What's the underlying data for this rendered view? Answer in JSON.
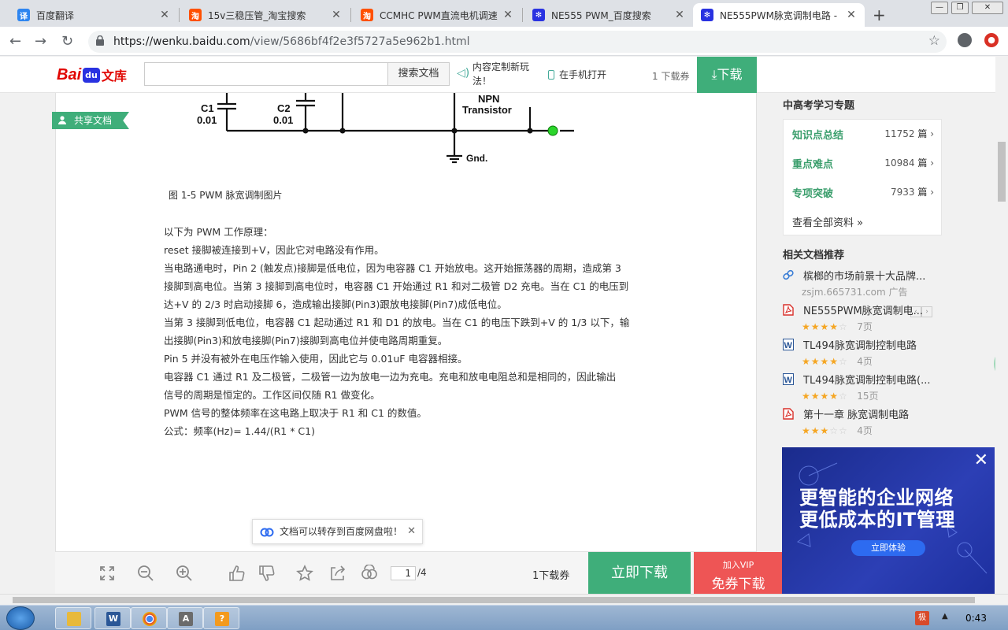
{
  "browser": {
    "tabs": [
      {
        "title": "百度翻译",
        "icon": "baidu-translate-icon",
        "icon_color": "#2d85f0",
        "icon_glyph": "译"
      },
      {
        "title": "15v三稳压管_淘宝搜索",
        "icon": "taobao-icon",
        "icon_color": "#ff5000",
        "icon_glyph": "淘"
      },
      {
        "title": "CCMHC PWM直流电机调速",
        "icon": "taobao-icon",
        "icon_color": "#ff5000",
        "icon_glyph": "淘"
      },
      {
        "title": "NE555 PWM_百度搜索",
        "icon": "baidu-paw-icon",
        "icon_color": "#2932e1",
        "icon_glyph": "✻"
      },
      {
        "title": "NE555PWM脉宽调制电路 -",
        "icon": "baidu-paw-icon",
        "icon_color": "#2932e1",
        "icon_glyph": "✻",
        "active": true
      }
    ],
    "url_host": "https://wenku.baidu.com",
    "url_path": "/view/5686bf4f2e3f5727a5e962b1.html"
  },
  "header": {
    "logo_bai": "Bai",
    "logo_du": "du",
    "logo_wenku": "文库",
    "search_placeholder": "",
    "search_button": "搜索文档",
    "custom_text": "内容定制新玩法！",
    "mobile_text": "在手机打开",
    "download_count": "1 下载券",
    "download_button": "下载"
  },
  "share_tag": "共享文档",
  "figure": {
    "caption": "图 1-5  PWM 脉宽调制图片",
    "labels": {
      "c1": "C1",
      "c1_val": "0.01",
      "c2": "C2",
      "c2_val": "0.01",
      "npn": "NPN",
      "transistor": "Transistor",
      "gnd": "Gnd."
    }
  },
  "body_lines": [
    "以下为 PWM 工作原理：",
    "reset 接脚被连接到+V，因此它对电路没有作用。",
    "当电路通电时，Pin 2 (触发点)接脚是低电位，因为电容器 C1 开始放电。这开始振荡器的周期，造成第 3",
    "接脚到高电位。当第 3 接脚到高电位时，电容器 C1 开始通过 R1 和对二极管 D2 充电。当在 C1 的电压到",
    "达+V 的 2/3 时启动接脚 6，造成输出接脚(Pin3)跟放电接脚(Pin7)成低电位。",
    "当第 3 接脚到低电位，电容器 C1 起动通过 R1 和 D1 的放电。当在 C1 的电压下跌到+V 的 1/3 以下，输",
    "出接脚(Pin3)和放电接脚(Pin7)接脚到高电位并使电路周期重复。",
    "Pin  5 并没有被外在电压作输入使用，因此它与 0.01uF 电容器相接。",
    "电容器 C1 通过 R1 及二极管，二极管一边为放电一边为充电。充电和放电电阻总和是相同的，因此输出",
    "信号的周期是恒定的。工作区间仅随  R1 做变化。",
    "PWM 信号的整体频率在这电路上取决于 R1 和 C1 的数值。",
    "公式：频率(Hz)=  1.44/(R1  *  C1)"
  ],
  "save_tip": "文档可以转存到百度网盘啦！",
  "bottom_bar": {
    "page_current": "1",
    "page_total": "/4",
    "download_count": "1下载券",
    "download_now": "立即下载",
    "vip_line1": "加入VIP",
    "vip_line2": "免券下载"
  },
  "sidebar": {
    "topic_title": "中高考学习专题",
    "topics": [
      {
        "name": "知识点总结",
        "count": "11752",
        "unit": "篇"
      },
      {
        "name": "重点难点",
        "count": "10984",
        "unit": "篇"
      },
      {
        "name": "专项突破",
        "count": "7933",
        "unit": "篇"
      }
    ],
    "view_all": "查看全部资料 »",
    "related_title": "相关文档推荐",
    "related": [
      {
        "title": "槟榔的市场前景十大品牌...",
        "sub": "zsjm.665731.com    广告",
        "icon": "link-icon",
        "icon_color": "#3b7ed6",
        "stars": 0
      },
      {
        "title": "NE555PWM脉宽调制电...",
        "pages": "7页",
        "icon": "pdf-icon",
        "icon_color": "#d9312b",
        "stars": 4
      },
      {
        "title": "TL494脉宽调制控制电路",
        "pages": "4页",
        "icon": "word-icon",
        "icon_color": "#2b5797",
        "stars": 4
      },
      {
        "title": "TL494脉宽调制控制电路(...",
        "pages": "15页",
        "icon": "word-icon",
        "icon_color": "#2b5797",
        "stars": 4
      },
      {
        "title": "第十一章 脉宽调制电路",
        "pages": "4页",
        "icon": "pdf-icon",
        "icon_color": "#d9312b",
        "stars": 3
      }
    ]
  },
  "ad": {
    "line1": "更智能的企业网络",
    "line2": "更低成本的IT管理",
    "cta": "立即体验"
  },
  "float_badge": "41",
  "taskbar": {
    "ime": "极",
    "clock": "0:43"
  },
  "colors": {
    "accent_green": "#3fae7a",
    "vip_red": "#e55555",
    "baidu_red": "#e10601",
    "baidu_blue": "#2932e1"
  }
}
